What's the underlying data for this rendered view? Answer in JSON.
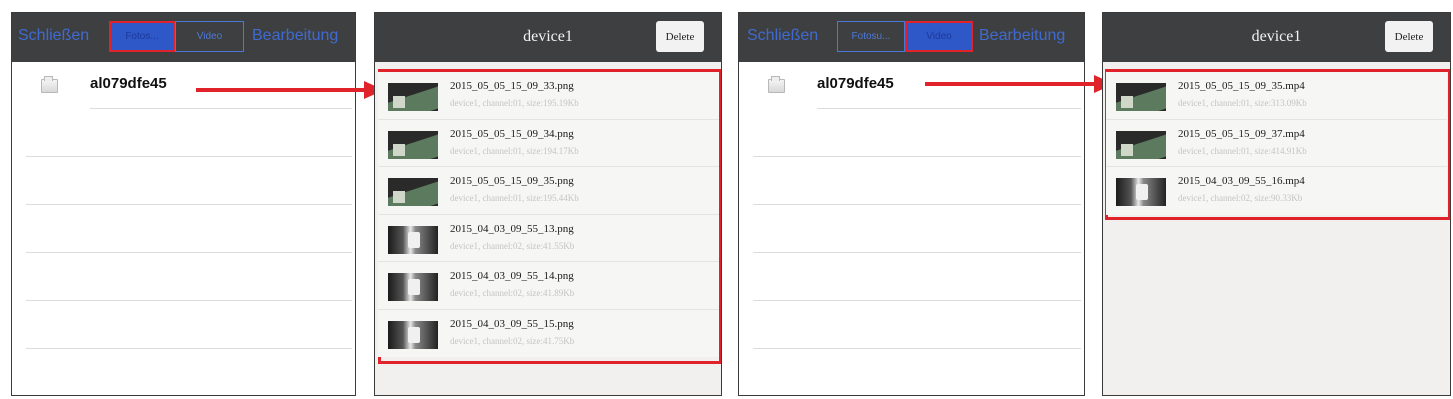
{
  "screen1": {
    "nav": {
      "close": "Schließen",
      "photo_tab": "Fotos...",
      "video_tab": "Video",
      "edit": "Bearbeitung"
    },
    "folder": "al079dfe45"
  },
  "screen2": {
    "title": "device1",
    "delete": "Delete",
    "files": [
      {
        "name": "2015_05_05_15_09_33.png",
        "meta": "device1, channel:01, size:195.19Kb",
        "thumb": "t1"
      },
      {
        "name": "2015_05_05_15_09_34.png",
        "meta": "device1, channel:01, size:194.17Kb",
        "thumb": "t1"
      },
      {
        "name": "2015_05_05_15_09_35.png",
        "meta": "device1, channel:01, size:195.44Kb",
        "thumb": "t1"
      },
      {
        "name": "2015_04_03_09_55_13.png",
        "meta": "device1, channel:02, size:41.55Kb",
        "thumb": "t2"
      },
      {
        "name": "2015_04_03_09_55_14.png",
        "meta": "device1, channel:02, size:41.89Kb",
        "thumb": "t2"
      },
      {
        "name": "2015_04_03_09_55_15.png",
        "meta": "device1, channel:02, size:41.75Kb",
        "thumb": "t2"
      }
    ]
  },
  "screen3": {
    "nav": {
      "close": "Schließen",
      "photo_tab": "Fotosu...",
      "video_tab": "Video",
      "edit": "Bearbeitung"
    },
    "folder": "al079dfe45"
  },
  "screen4": {
    "title": "device1",
    "delete": "Delete",
    "files": [
      {
        "name": "2015_05_05_15_09_35.mp4",
        "meta": "device1, channel:01, size:313.09Kb",
        "thumb": "t1"
      },
      {
        "name": "2015_05_05_15_09_37.mp4",
        "meta": "device1, channel:01, size:414.91Kb",
        "thumb": "t1"
      },
      {
        "name": "2015_04_03_09_55_16.mp4",
        "meta": "device1, channel:02, size:90.33Kb",
        "thumb": "t2"
      }
    ]
  },
  "colors": {
    "accent": "#3f6bd0",
    "highlight": "#e0222b",
    "bar": "#3e3f41"
  },
  "icons": {
    "folder": "folder-icon",
    "arrow": "arrow-right-icon"
  }
}
